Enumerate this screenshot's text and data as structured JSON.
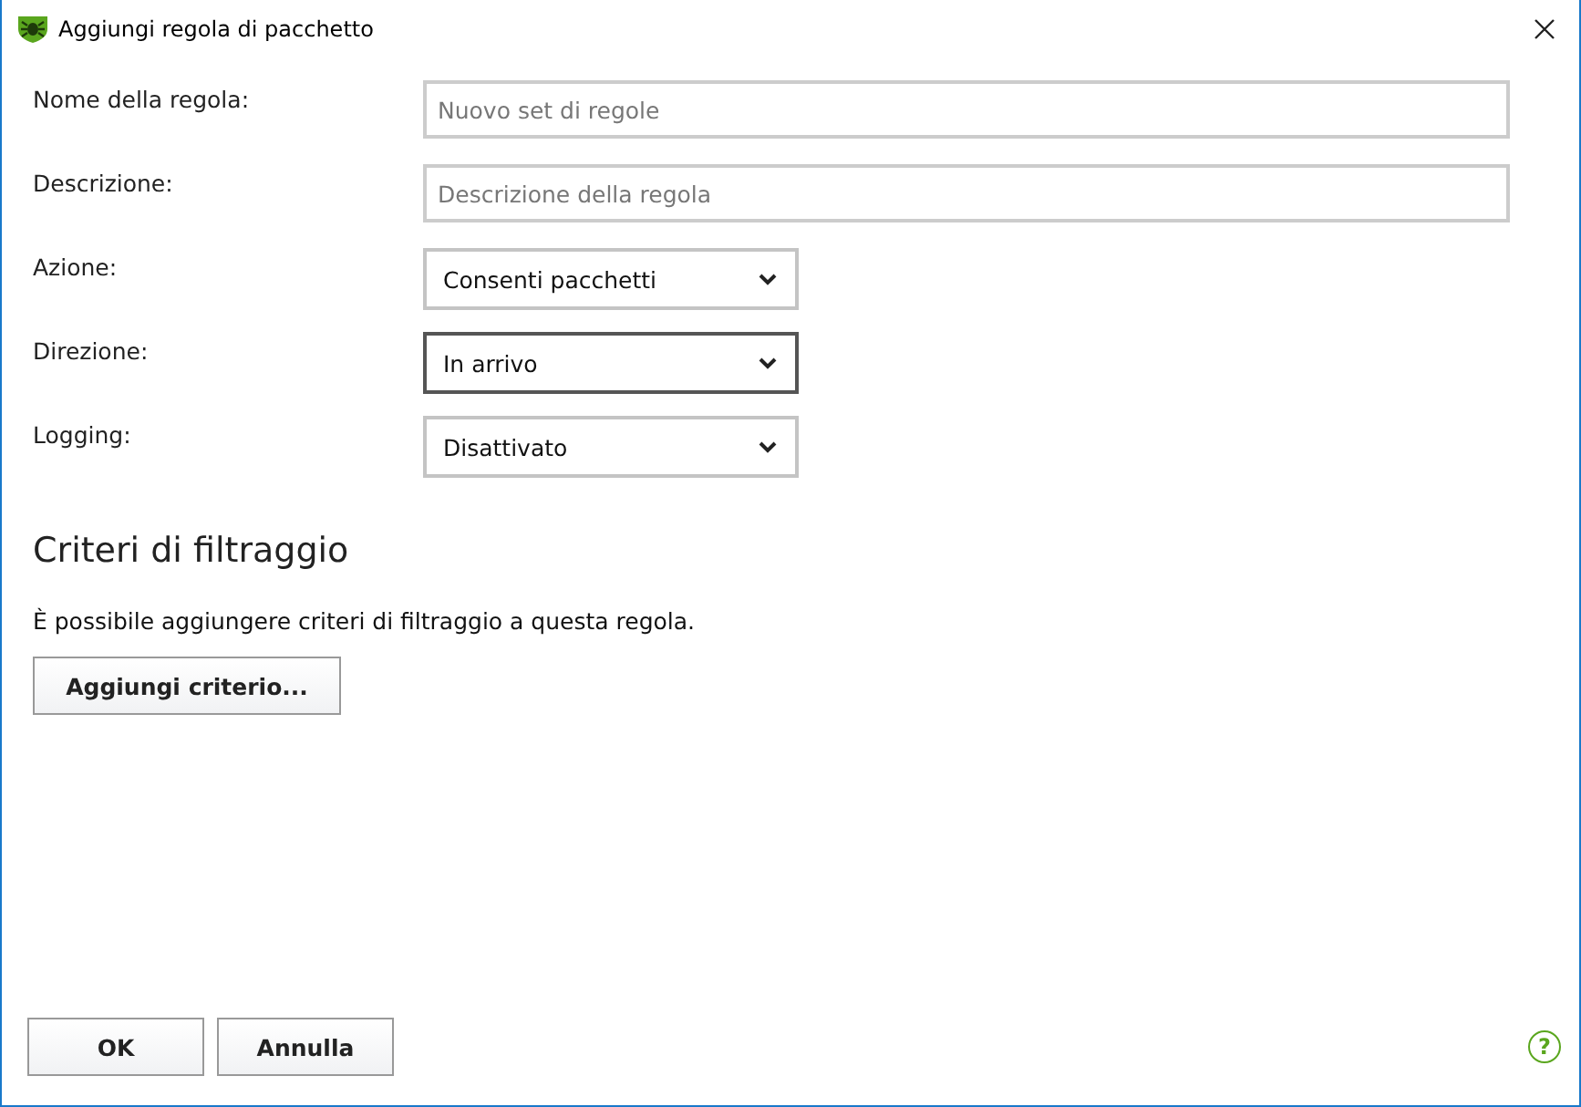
{
  "window": {
    "title": "Aggiungi regola di pacchetto"
  },
  "fields": [
    {
      "kind": "text",
      "label": "Nome della regola:",
      "placeholder": "Nuovo set di regole"
    },
    {
      "kind": "text",
      "label": "Descrizione:",
      "placeholder": "Descrizione della regola"
    },
    {
      "kind": "dropdown",
      "label": "Azione:",
      "value": "Consenti pacchetti",
      "focused": false
    },
    {
      "kind": "dropdown",
      "label": "Direzione:",
      "value": "In arrivo",
      "focused": true
    },
    {
      "kind": "dropdown",
      "label": "Logging:",
      "value": "Disattivato",
      "focused": false
    }
  ],
  "filter_section": {
    "heading": "Criteri di filtraggio",
    "description": "È possibile aggiungere criteri di filtraggio a questa regola.",
    "button": "Aggiungi criterio..."
  },
  "buttons": [
    "OK",
    "Annulla"
  ],
  "help": "?"
}
